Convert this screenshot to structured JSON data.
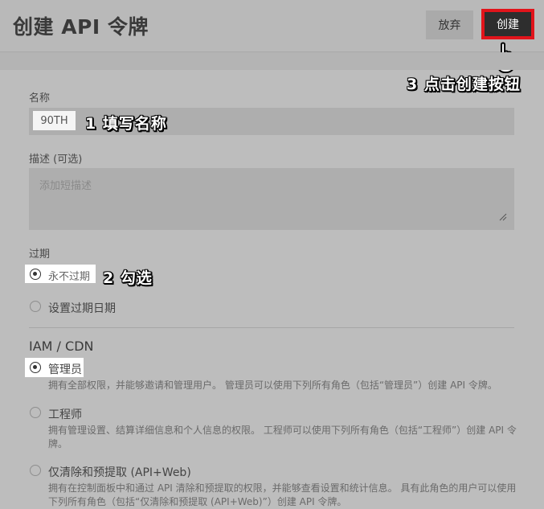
{
  "header": {
    "title": "创建 API 令牌",
    "discard_label": "放弃",
    "create_label": "创建"
  },
  "annotations": {
    "step1": "1 填写名称",
    "step2": "2 勾选",
    "step3": "3 点击创建按钮"
  },
  "form": {
    "name_label": "名称",
    "name_value": "90TH",
    "desc_label": "描述 (可选)",
    "desc_placeholder": "添加短描述",
    "expiry_label": "过期",
    "expiry_options": [
      {
        "label": "永不过期",
        "selected": true
      },
      {
        "label": "设置过期日期",
        "selected": false
      }
    ],
    "iam_label": "IAM / CDN",
    "roles": [
      {
        "label": "管理员",
        "selected": true,
        "desc": "拥有全部权限，并能够邀请和管理用户。 管理员可以使用下列所有角色（包括“管理员”）创建 API 令牌。"
      },
      {
        "label": "工程师",
        "selected": false,
        "desc": "拥有管理设置、结算详细信息和个人信息的权限。 工程师可以使用下列所有角色（包括“工程师”）创建 API 令牌。"
      },
      {
        "label": "仅清除和预提取 (API+Web)",
        "selected": false,
        "desc": "拥有在控制面板中和通过 API 清除和预提取的权限，并能够查看设置和统计信息。 具有此角色的用户可以使用下列所有角色（包括“仅清除和预提取 (API+Web)”）创建 API 令牌。"
      }
    ]
  }
}
